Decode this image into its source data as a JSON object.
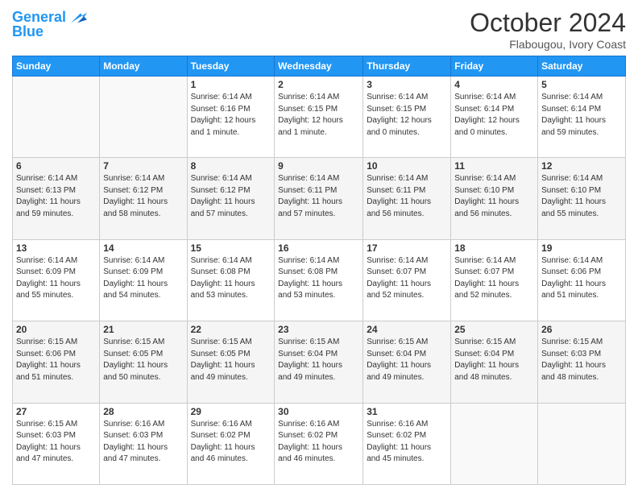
{
  "header": {
    "logo_line1": "General",
    "logo_line2": "Blue",
    "month_year": "October 2024",
    "location": "Flabougou, Ivory Coast"
  },
  "days_of_week": [
    "Sunday",
    "Monday",
    "Tuesday",
    "Wednesday",
    "Thursday",
    "Friday",
    "Saturday"
  ],
  "weeks": [
    [
      {
        "day": "",
        "info": ""
      },
      {
        "day": "",
        "info": ""
      },
      {
        "day": "1",
        "info": "Sunrise: 6:14 AM\nSunset: 6:16 PM\nDaylight: 12 hours\nand 1 minute."
      },
      {
        "day": "2",
        "info": "Sunrise: 6:14 AM\nSunset: 6:15 PM\nDaylight: 12 hours\nand 1 minute."
      },
      {
        "day": "3",
        "info": "Sunrise: 6:14 AM\nSunset: 6:15 PM\nDaylight: 12 hours\nand 0 minutes."
      },
      {
        "day": "4",
        "info": "Sunrise: 6:14 AM\nSunset: 6:14 PM\nDaylight: 12 hours\nand 0 minutes."
      },
      {
        "day": "5",
        "info": "Sunrise: 6:14 AM\nSunset: 6:14 PM\nDaylight: 11 hours\nand 59 minutes."
      }
    ],
    [
      {
        "day": "6",
        "info": "Sunrise: 6:14 AM\nSunset: 6:13 PM\nDaylight: 11 hours\nand 59 minutes."
      },
      {
        "day": "7",
        "info": "Sunrise: 6:14 AM\nSunset: 6:12 PM\nDaylight: 11 hours\nand 58 minutes."
      },
      {
        "day": "8",
        "info": "Sunrise: 6:14 AM\nSunset: 6:12 PM\nDaylight: 11 hours\nand 57 minutes."
      },
      {
        "day": "9",
        "info": "Sunrise: 6:14 AM\nSunset: 6:11 PM\nDaylight: 11 hours\nand 57 minutes."
      },
      {
        "day": "10",
        "info": "Sunrise: 6:14 AM\nSunset: 6:11 PM\nDaylight: 11 hours\nand 56 minutes."
      },
      {
        "day": "11",
        "info": "Sunrise: 6:14 AM\nSunset: 6:10 PM\nDaylight: 11 hours\nand 56 minutes."
      },
      {
        "day": "12",
        "info": "Sunrise: 6:14 AM\nSunset: 6:10 PM\nDaylight: 11 hours\nand 55 minutes."
      }
    ],
    [
      {
        "day": "13",
        "info": "Sunrise: 6:14 AM\nSunset: 6:09 PM\nDaylight: 11 hours\nand 55 minutes."
      },
      {
        "day": "14",
        "info": "Sunrise: 6:14 AM\nSunset: 6:09 PM\nDaylight: 11 hours\nand 54 minutes."
      },
      {
        "day": "15",
        "info": "Sunrise: 6:14 AM\nSunset: 6:08 PM\nDaylight: 11 hours\nand 53 minutes."
      },
      {
        "day": "16",
        "info": "Sunrise: 6:14 AM\nSunset: 6:08 PM\nDaylight: 11 hours\nand 53 minutes."
      },
      {
        "day": "17",
        "info": "Sunrise: 6:14 AM\nSunset: 6:07 PM\nDaylight: 11 hours\nand 52 minutes."
      },
      {
        "day": "18",
        "info": "Sunrise: 6:14 AM\nSunset: 6:07 PM\nDaylight: 11 hours\nand 52 minutes."
      },
      {
        "day": "19",
        "info": "Sunrise: 6:14 AM\nSunset: 6:06 PM\nDaylight: 11 hours\nand 51 minutes."
      }
    ],
    [
      {
        "day": "20",
        "info": "Sunrise: 6:15 AM\nSunset: 6:06 PM\nDaylight: 11 hours\nand 51 minutes."
      },
      {
        "day": "21",
        "info": "Sunrise: 6:15 AM\nSunset: 6:05 PM\nDaylight: 11 hours\nand 50 minutes."
      },
      {
        "day": "22",
        "info": "Sunrise: 6:15 AM\nSunset: 6:05 PM\nDaylight: 11 hours\nand 49 minutes."
      },
      {
        "day": "23",
        "info": "Sunrise: 6:15 AM\nSunset: 6:04 PM\nDaylight: 11 hours\nand 49 minutes."
      },
      {
        "day": "24",
        "info": "Sunrise: 6:15 AM\nSunset: 6:04 PM\nDaylight: 11 hours\nand 49 minutes."
      },
      {
        "day": "25",
        "info": "Sunrise: 6:15 AM\nSunset: 6:04 PM\nDaylight: 11 hours\nand 48 minutes."
      },
      {
        "day": "26",
        "info": "Sunrise: 6:15 AM\nSunset: 6:03 PM\nDaylight: 11 hours\nand 48 minutes."
      }
    ],
    [
      {
        "day": "27",
        "info": "Sunrise: 6:15 AM\nSunset: 6:03 PM\nDaylight: 11 hours\nand 47 minutes."
      },
      {
        "day": "28",
        "info": "Sunrise: 6:16 AM\nSunset: 6:03 PM\nDaylight: 11 hours\nand 47 minutes."
      },
      {
        "day": "29",
        "info": "Sunrise: 6:16 AM\nSunset: 6:02 PM\nDaylight: 11 hours\nand 46 minutes."
      },
      {
        "day": "30",
        "info": "Sunrise: 6:16 AM\nSunset: 6:02 PM\nDaylight: 11 hours\nand 46 minutes."
      },
      {
        "day": "31",
        "info": "Sunrise: 6:16 AM\nSunset: 6:02 PM\nDaylight: 11 hours\nand 45 minutes."
      },
      {
        "day": "",
        "info": ""
      },
      {
        "day": "",
        "info": ""
      }
    ]
  ]
}
